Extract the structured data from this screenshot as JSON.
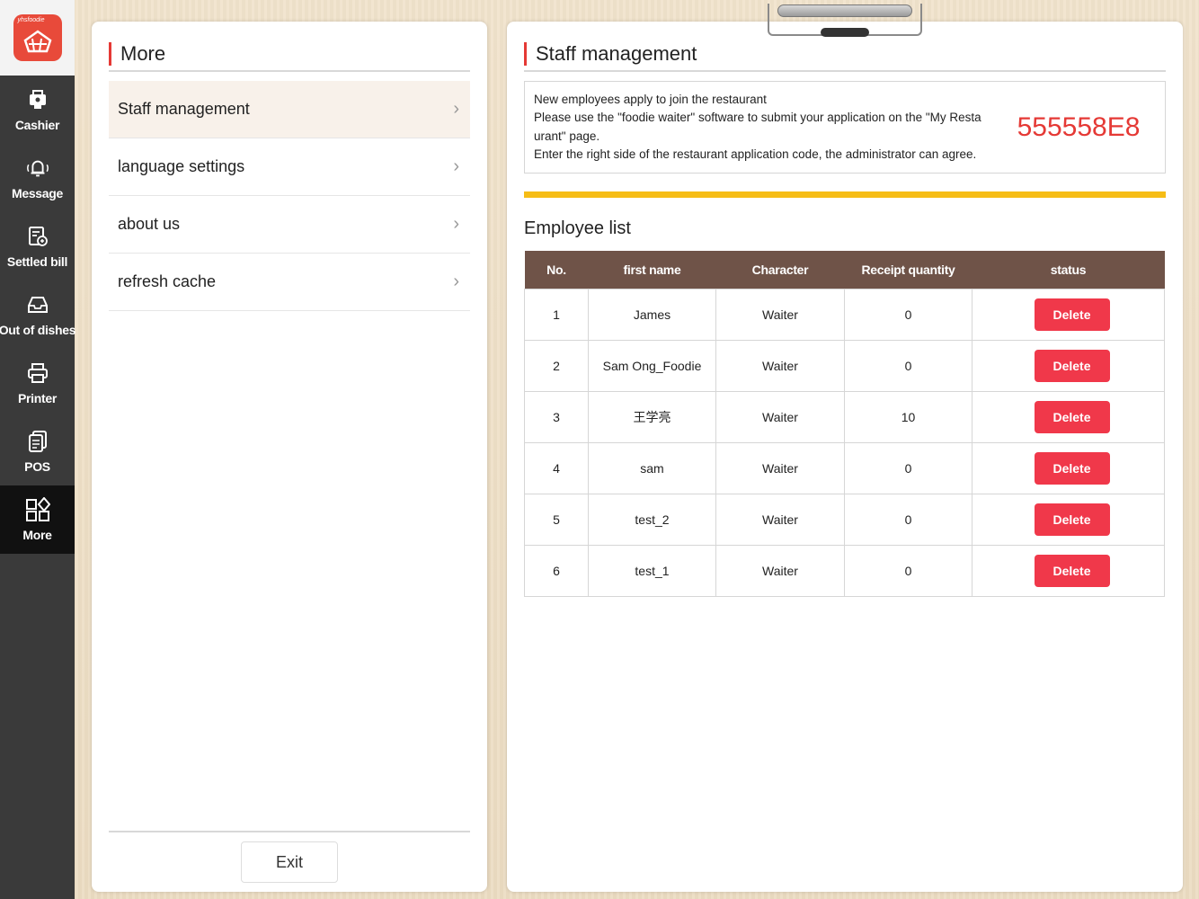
{
  "app": {
    "logo_text": "yhsfoodie",
    "colors": {
      "brand_red": "#e84a3a",
      "sidebar_bg": "#3a3a3a",
      "table_header": "#6f5348",
      "accent_yellow": "#f6bd16",
      "delete_red": "#f0384a"
    }
  },
  "sidebar": {
    "items": [
      {
        "label": "Cashier",
        "icon": "cashier-icon"
      },
      {
        "label": "Message",
        "icon": "bell-icon"
      },
      {
        "label": "Settled bill",
        "icon": "bill-icon"
      },
      {
        "label": "Out of dishes",
        "icon": "tray-icon"
      },
      {
        "label": "Printer",
        "icon": "printer-icon"
      },
      {
        "label": "POS",
        "icon": "pos-icon"
      },
      {
        "label": "More",
        "icon": "grid-icon",
        "active": true
      }
    ]
  },
  "left_panel": {
    "title": "More",
    "menu": [
      {
        "label": "Staff management",
        "active": true
      },
      {
        "label": "language settings"
      },
      {
        "label": "about us"
      },
      {
        "label": "refresh cache"
      }
    ],
    "exit_label": "Exit"
  },
  "right_panel": {
    "title": "Staff management",
    "info": {
      "line1": "New employees apply to join the restaurant",
      "line2": "Please use the \"foodie waiter\" software to submit your application on the \"My Resta urant\" page.",
      "line3": "Enter the right side of the restaurant application code, the administrator can agree.",
      "code": "555558E8"
    },
    "list_title": "Employee list",
    "table": {
      "headers": [
        "No.",
        "first name",
        "Character",
        "Receipt quantity",
        "status"
      ],
      "rows": [
        {
          "no": "1",
          "name": "James",
          "character": "Waiter",
          "qty": "0",
          "action": "Delete"
        },
        {
          "no": "2",
          "name": "Sam Ong_Foodie",
          "character": "Waiter",
          "qty": "0",
          "action": "Delete"
        },
        {
          "no": "3",
          "name": "王学亮",
          "character": "Waiter",
          "qty": "10",
          "action": "Delete"
        },
        {
          "no": "4",
          "name": "sam",
          "character": "Waiter",
          "qty": "0",
          "action": "Delete"
        },
        {
          "no": "5",
          "name": "test_2",
          "character": "Waiter",
          "qty": "0",
          "action": "Delete"
        },
        {
          "no": "6",
          "name": "test_1",
          "character": "Waiter",
          "qty": "0",
          "action": "Delete"
        }
      ]
    }
  }
}
